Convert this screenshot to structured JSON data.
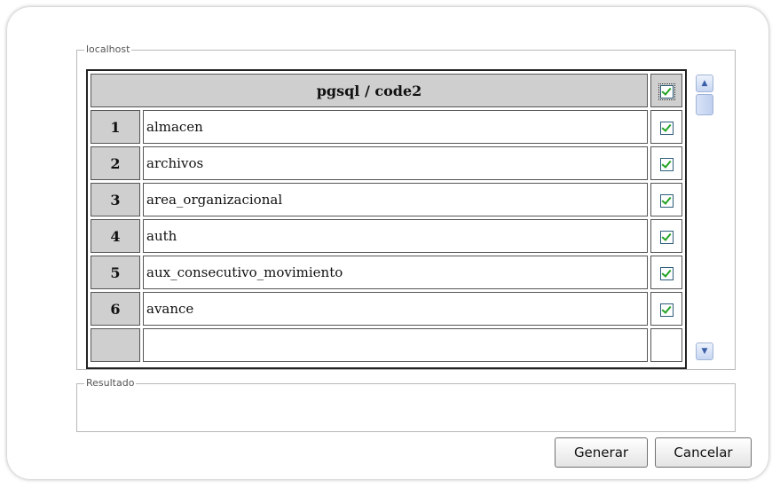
{
  "localhost_group": {
    "legend": "localhost",
    "table": {
      "header_title": "pgsql / code2",
      "rows": [
        {
          "index": "1",
          "name": "almacen"
        },
        {
          "index": "2",
          "name": "archivos"
        },
        {
          "index": "3",
          "name": "area_organizacional"
        },
        {
          "index": "4",
          "name": "auth"
        },
        {
          "index": "5",
          "name": "aux_consecutivo_movimiento"
        },
        {
          "index": "6",
          "name": "avance"
        },
        {
          "index": "",
          "name": ""
        }
      ]
    }
  },
  "result_group": {
    "legend": "Resultado"
  },
  "buttons": {
    "generate": "Generar",
    "cancel": "Cancelar"
  },
  "icons": {
    "scroll_up": "arrow-up-icon",
    "scroll_down": "arrow-down-icon",
    "checkbox": "checked-checkbox-icon"
  },
  "colors": {
    "header_bg": "#cfcfcf",
    "check_color": "#22a322",
    "scrollbar_accent": "#3a5ea8"
  }
}
